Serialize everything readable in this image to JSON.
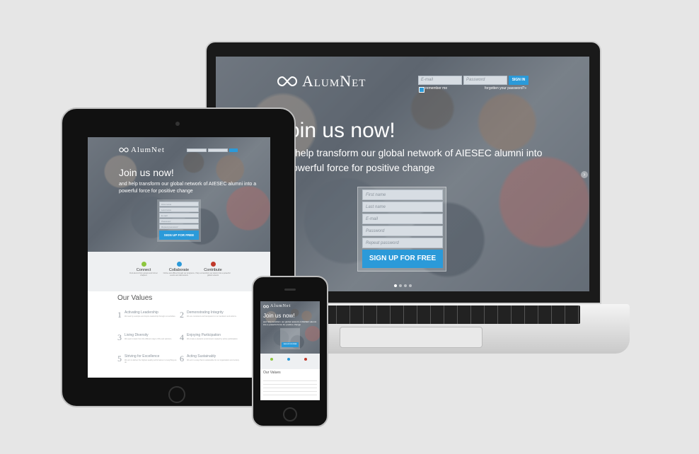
{
  "brand": {
    "name": "AlumNet",
    "logo_icon": "infinity-icon"
  },
  "login": {
    "email_placeholder": "E-mail",
    "password_placeholder": "Password",
    "signin_label": "SIGN IN",
    "remember_label": "remember me",
    "forgot_label": "forgotten your password?»"
  },
  "hero": {
    "title_laptop": "oin us now!",
    "subtitle_laptop_line1": "help transform our global network of AIESEC alumni into",
    "subtitle_laptop_line2": "owerful force for positive change",
    "title": "Join us now!",
    "subtitle": "and help transform our global network of AIESEC alumni into a powerful force for positive change"
  },
  "signup": {
    "first_name": "First name",
    "last_name": "Last name",
    "email": "E-mail",
    "password": "Password",
    "repeat_password": "Repeat password",
    "button": "SIGN UP FOR FREE"
  },
  "features": [
    {
      "title": "Connect",
      "text": "Find alumni from groups and former chapters",
      "icon": "connect-icon",
      "color": "#8dc63f"
    },
    {
      "title": "Collaborate",
      "text": "Online and offline through our programs, events and discussions",
      "icon": "collaborate-icon",
      "color": "#2b9ad9"
    },
    {
      "title": "Contribute",
      "text": "Help us transform our alumni into a powerful global network",
      "icon": "contribute-icon",
      "color": "#c0392b"
    }
  ],
  "values": {
    "heading": "Our Values",
    "items": [
      {
        "num": "1",
        "title": "Activating Leadership",
        "text": "We lead by example and inspire leadership through our activities."
      },
      {
        "num": "2",
        "title": "Demonstrating Integrity",
        "text": "We are consistent and transparent in our decisions and actions."
      },
      {
        "num": "3",
        "title": "Living Diversity",
        "text": "We seek to learn from the different ways of life and opinions."
      },
      {
        "num": "4",
        "title": "Enjoying Participation",
        "text": "We create a dynamic environment created by active participation."
      },
      {
        "num": "5",
        "title": "Striving for Excellence",
        "text": "We aim to deliver the highest quality performance in everything we do."
      },
      {
        "num": "6",
        "title": "Acting Sustainably",
        "text": "We act in a way that is sustainable for our organisation and society."
      }
    ]
  }
}
